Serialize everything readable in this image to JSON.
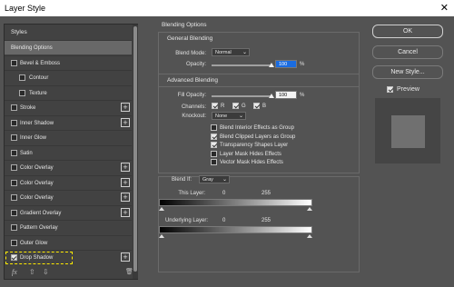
{
  "window": {
    "title": "Layer Style",
    "close": "✕"
  },
  "styles_panel": {
    "header": "Styles",
    "items": [
      {
        "label": "Blending Options",
        "checkbox": false,
        "selected": true
      },
      {
        "label": "Bevel & Emboss",
        "checkbox": true,
        "checked": false,
        "plus": false
      },
      {
        "label": "Contour",
        "checkbox": true,
        "checked": false,
        "indent": true
      },
      {
        "label": "Texture",
        "checkbox": true,
        "checked": false,
        "indent": true
      },
      {
        "label": "Stroke",
        "checkbox": true,
        "checked": false,
        "plus": true
      },
      {
        "label": "Inner Shadow",
        "checkbox": true,
        "checked": false,
        "plus": true
      },
      {
        "label": "Inner Glow",
        "checkbox": true,
        "checked": false
      },
      {
        "label": "Satin",
        "checkbox": true,
        "checked": false
      },
      {
        "label": "Color Overlay",
        "checkbox": true,
        "checked": false,
        "plus": true
      },
      {
        "label": "Color Overlay",
        "checkbox": true,
        "checked": false,
        "plus": true
      },
      {
        "label": "Color Overlay",
        "checkbox": true,
        "checked": false,
        "plus": true
      },
      {
        "label": "Gradient Overlay",
        "checkbox": true,
        "checked": false,
        "plus": true
      },
      {
        "label": "Pattern Overlay",
        "checkbox": true,
        "checked": false
      },
      {
        "label": "Outer Glow",
        "checkbox": true,
        "checked": false
      },
      {
        "label": "Drop Shadow",
        "checkbox": true,
        "checked": true,
        "plus": true
      }
    ],
    "footer": {
      "fx": "fx",
      "up": "⇧",
      "down": "⇩",
      "trash": "🗑"
    }
  },
  "blending": {
    "title": "Blending Options",
    "general": {
      "title": "General Blending",
      "mode_label": "Blend Mode:",
      "mode_value": "Normal",
      "opacity_label": "Opacity:",
      "opacity_value": "100",
      "opacity_pct": 100,
      "unit": "%"
    },
    "advanced": {
      "title": "Advanced Blending",
      "fill_label": "Fill Opacity:",
      "fill_value": "100",
      "fill_pct": 100,
      "unit": "%",
      "channels_label": "Channels:",
      "channels": [
        {
          "label": "R",
          "checked": true
        },
        {
          "label": "G",
          "checked": true
        },
        {
          "label": "B",
          "checked": true
        }
      ],
      "knockout_label": "Knockout:",
      "knockout_value": "None",
      "options": [
        {
          "label": "Blend Interior Effects as Group",
          "checked": false
        },
        {
          "label": "Blend Clipped Layers as Group",
          "checked": true
        },
        {
          "label": "Transparency Shapes Layer",
          "checked": true
        },
        {
          "label": "Layer Mask Hides Effects",
          "checked": false
        },
        {
          "label": "Vector Mask Hides Effects",
          "checked": false
        }
      ]
    },
    "blend_if": {
      "label": "Blend If:",
      "value": "Gray",
      "this_layer": "This Layer:",
      "underlying": "Underlying Layer:",
      "low": "0",
      "high": "255"
    }
  },
  "buttons": {
    "ok": "OK",
    "cancel": "Cancel",
    "new_style": "New Style...",
    "preview": "Preview",
    "preview_checked": true
  }
}
